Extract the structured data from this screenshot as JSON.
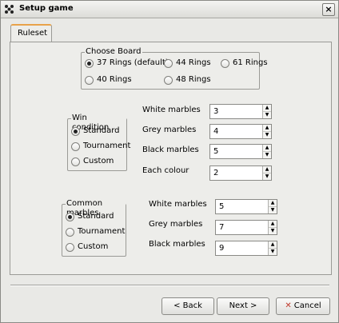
{
  "window": {
    "title": "Setup game"
  },
  "tab": {
    "label": "Ruleset"
  },
  "board": {
    "title": "Choose Board",
    "options": [
      "37 Rings (default)",
      "44 Rings",
      "61 Rings",
      "40 Rings",
      "48 Rings"
    ],
    "selected": "37 Rings (default)"
  },
  "win_condition": {
    "title": "Win condition",
    "options": [
      "Standard",
      "Tournament",
      "Custom"
    ],
    "selected": "Standard",
    "fields": [
      {
        "label": "White marbles",
        "value": "3"
      },
      {
        "label": "Grey marbles",
        "value": "4"
      },
      {
        "label": "Black marbles",
        "value": "5"
      },
      {
        "label": "Each colour",
        "value": "2"
      }
    ]
  },
  "common_marbles": {
    "title": "Common marbles",
    "options": [
      "Standard",
      "Tournament",
      "Custom"
    ],
    "selected": "Standard",
    "fields": [
      {
        "label": "White marbles",
        "value": "5"
      },
      {
        "label": "Grey marbles",
        "value": "7"
      },
      {
        "label": "Black marbles",
        "value": "9"
      }
    ]
  },
  "buttons": {
    "back": "< Back",
    "next": "Next >",
    "cancel": "Cancel"
  },
  "colors": {
    "tab_accent": "#e8a24a",
    "cancel_icon": "#c0392b"
  }
}
